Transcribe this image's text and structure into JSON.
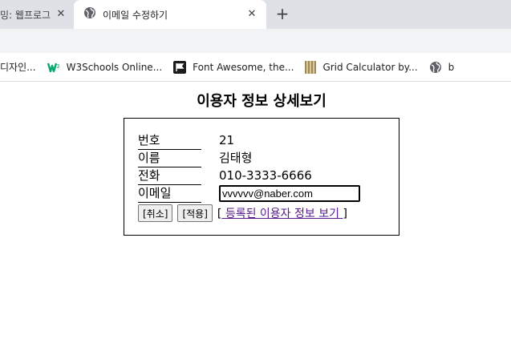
{
  "browser": {
    "tabs": [
      {
        "title": "밍: 웹프로그",
        "active": false
      },
      {
        "title": "이메일 수정하기",
        "active": true
      }
    ],
    "close_glyph": "✕",
    "new_tab_glyph": "+",
    "bookmarks": [
      {
        "label": "디자인...",
        "icon": "globe-icon"
      },
      {
        "label": "W3Schools Online...",
        "icon": "w3schools-icon"
      },
      {
        "label": "Font Awesome, the...",
        "icon": "flag-icon"
      },
      {
        "label": "Grid Calculator by...",
        "icon": "grid-icon"
      },
      {
        "label": "b",
        "icon": "globe-icon"
      }
    ]
  },
  "page": {
    "title": "이용자 정보 상세보기",
    "fields": [
      {
        "label": "번호",
        "value": "21"
      },
      {
        "label": "이름",
        "value": "김태형"
      },
      {
        "label": "전화",
        "value": "010-3333-6666"
      },
      {
        "label": "이메일",
        "value": "vvvvvv@naber.com"
      }
    ],
    "actions": {
      "cancel_label": "[취소]",
      "apply_label": "[적용]",
      "link_open": "[",
      "link_text": " 등록된 이용자 정보 보기 ",
      "link_close": "]"
    }
  },
  "colors": {
    "tabstrip": "#dee1e6",
    "toolbar": "#f1f3f4",
    "visited_link": "#551a8b"
  }
}
